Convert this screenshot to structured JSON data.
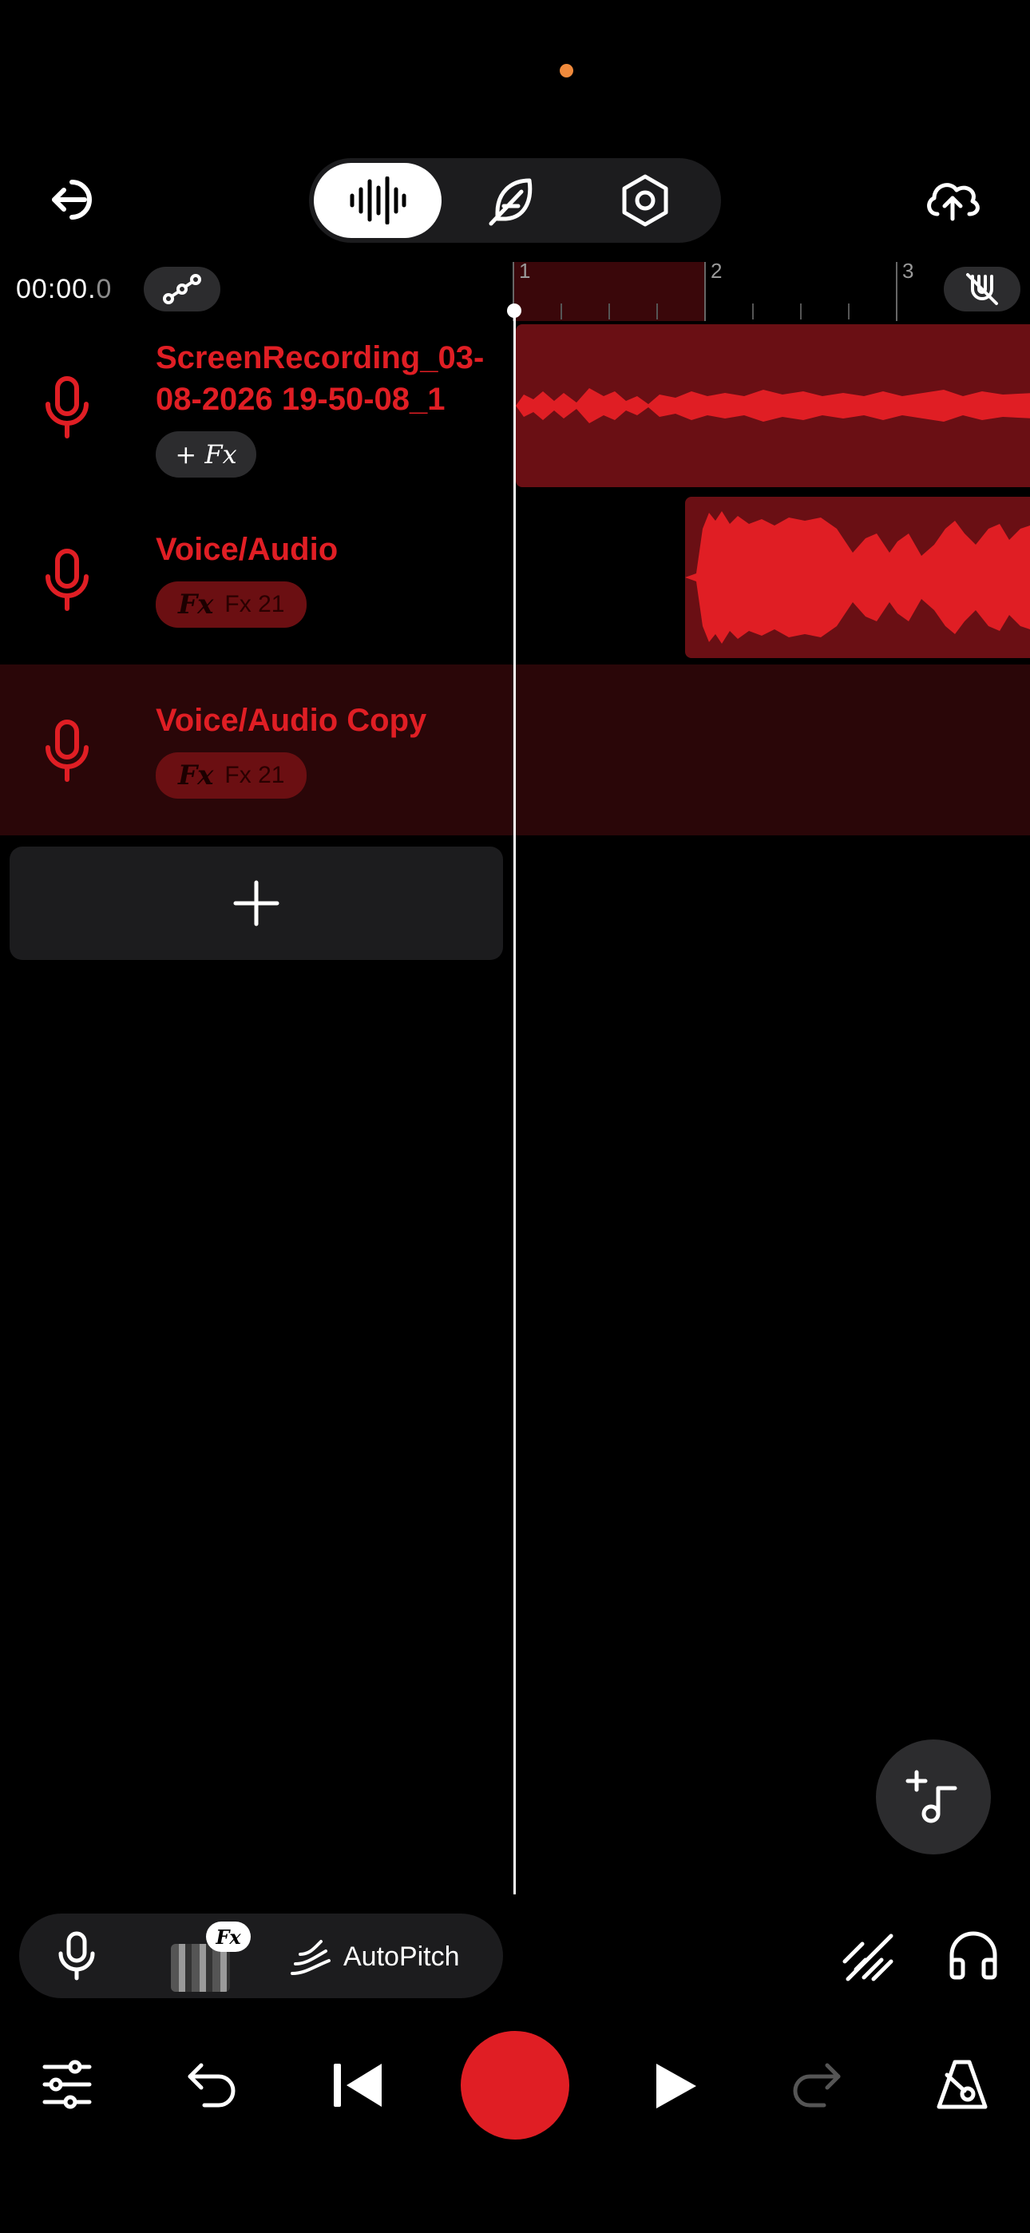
{
  "colors": {
    "accent": "#e01e24",
    "clip_dark": "#6a0f14",
    "selected_track_bg": "#2a0608",
    "panel": "#1c1c1e",
    "status_dot": "#f08a3c"
  },
  "header": {
    "exit_icon": "exit-arrow-icon",
    "tabs": [
      {
        "name": "waveform",
        "icon": "waveform-icon",
        "active": true
      },
      {
        "name": "feather",
        "icon": "feather-icon",
        "active": false
      },
      {
        "name": "settings",
        "icon": "hex-settings-icon",
        "active": false
      }
    ],
    "upload_icon": "cloud-upload-icon"
  },
  "timeline": {
    "time_main": "00:00.",
    "time_fraction": "0",
    "bars": [
      "1",
      "2",
      "3"
    ]
  },
  "tracks": [
    {
      "name": "ScreenRecording_03-08-2026 19-50-08_1",
      "fx_label": "+ Fx",
      "fx_count": ""
    },
    {
      "name": "Voice/Audio",
      "fx_label": "Fx",
      "fx_count": "Fx 21"
    },
    {
      "name": "Voice/Audio Copy",
      "fx_label": "Fx",
      "fx_count": "Fx 21"
    }
  ],
  "toolbar": {
    "fx_tag": "Fx",
    "autopitch_label": "AutoPitch"
  }
}
